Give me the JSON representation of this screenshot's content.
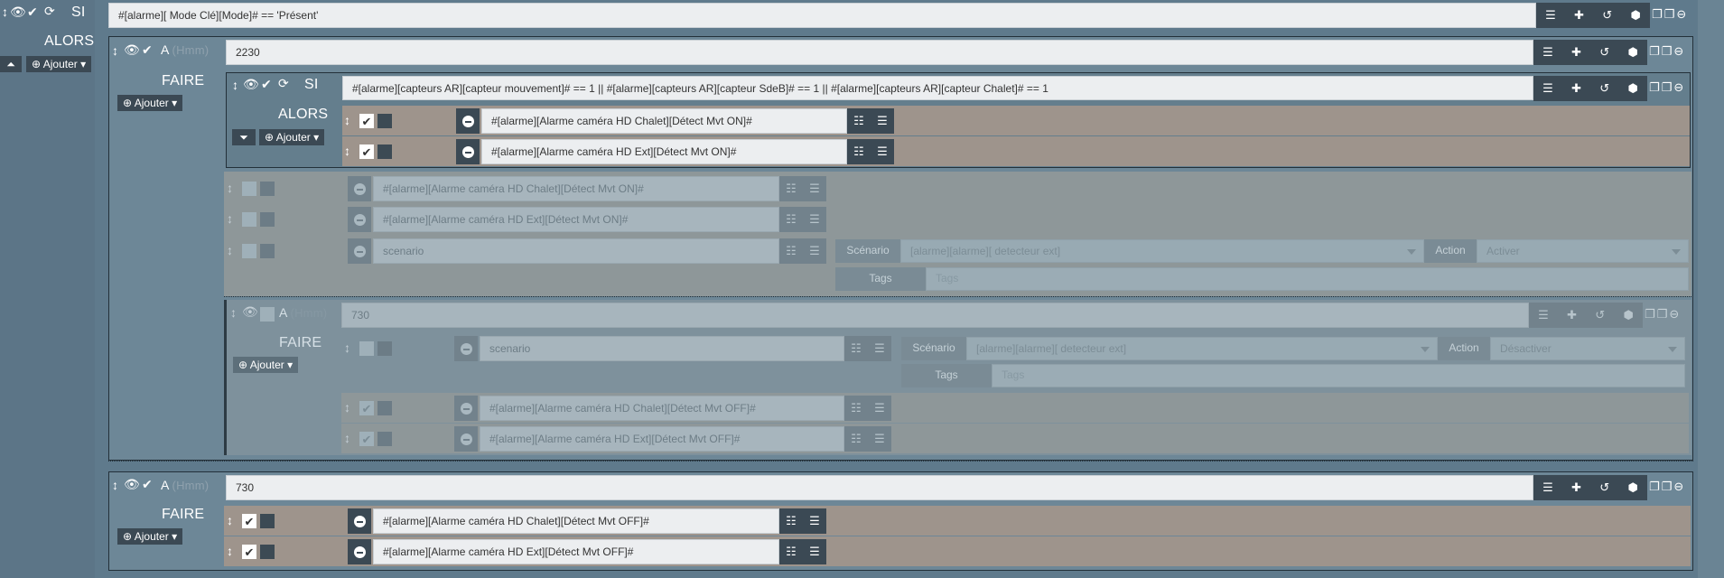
{
  "si_top": {
    "keyword": "SI",
    "condition": "#[alarme][ Mode Clé][Mode]# == 'Présent'"
  },
  "alors_top": {
    "keyword": "ALORS",
    "add_label": "Ajouter"
  },
  "a_block_1": {
    "keyword": "A",
    "unit": "(Hmm)",
    "value": "2230",
    "faire": "FAIRE",
    "add_label": "Ajouter"
  },
  "si_inner": {
    "keyword": "SI",
    "condition": "#[alarme][capteurs AR][capteur mouvement]# == 1 || #[alarme][capteurs AR][capteur SdeB]# == 1 || #[alarme][capteurs AR][capteur Chalet]# == 1",
    "alors": "ALORS",
    "add_label": "Ajouter"
  },
  "si_inner_actions": [
    {
      "cmd": "#[alarme][Alarme caméra HD Chalet][Détect Mvt ON]#"
    },
    {
      "cmd": "#[alarme][Alarme caméra HD Ext][Détect Mvt ON]#"
    }
  ],
  "faire_actions": [
    {
      "cmd": "#[alarme][Alarme caméra HD Chalet][Détect Mvt ON]#"
    },
    {
      "cmd": "#[alarme][Alarme caméra HD Ext][Détect Mvt ON]#"
    },
    {
      "cmd": "scenario",
      "scenario_label": "Scénario",
      "scenario_value": "[alarme][alarme][ detecteur ext]",
      "action_label": "Action",
      "action_value": "Activer",
      "tags_label": "Tags",
      "tags_placeholder": "Tags"
    }
  ],
  "a_block_nested": {
    "keyword": "A",
    "unit": "(Hmm)",
    "value": "730",
    "faire": "FAIRE",
    "add_label": "Ajouter"
  },
  "nested_actions": [
    {
      "cmd": "scenario",
      "scenario_label": "Scénario",
      "scenario_value": "[alarme][alarme][ detecteur ext]",
      "action_label": "Action",
      "action_value": "Désactiver",
      "tags_label": "Tags",
      "tags_placeholder": "Tags"
    },
    {
      "cmd": "#[alarme][Alarme caméra HD Chalet][Détect Mvt OFF]#"
    },
    {
      "cmd": "#[alarme][Alarme caméra HD Ext][Détect Mvt OFF]#"
    }
  ],
  "a_block_2": {
    "keyword": "A",
    "unit": "(Hmm)",
    "value": "730",
    "faire": "FAIRE",
    "add_label": "Ajouter"
  },
  "a2_actions": [
    {
      "cmd": "#[alarme][Alarme caméra HD Chalet][Détect Mvt OFF]#"
    },
    {
      "cmd": "#[alarme][Alarme caméra HD Ext][Détect Mvt OFF]#"
    }
  ],
  "colors": {
    "background": "#5f7a8c",
    "block_dark": "#3b4954",
    "action_row": "#9e948c",
    "field": "#eceef0"
  }
}
